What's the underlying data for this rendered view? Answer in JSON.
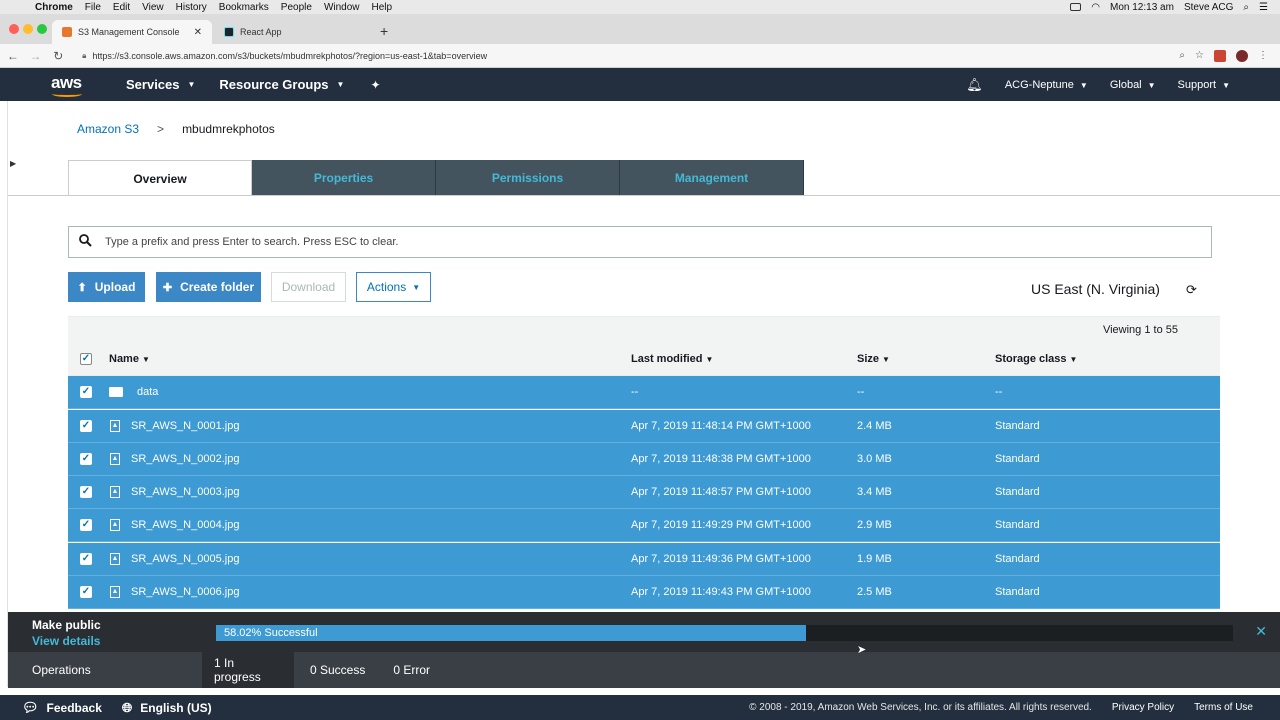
{
  "mac_menu": {
    "app": "Chrome",
    "items": [
      "File",
      "Edit",
      "View",
      "History",
      "Bookmarks",
      "People",
      "Window",
      "Help"
    ],
    "clock": "Mon 12:13 am",
    "user": "Steve ACG"
  },
  "browser": {
    "tabs": [
      {
        "title": "S3 Management Console",
        "active": true
      },
      {
        "title": "React App",
        "active": false
      }
    ],
    "url": "https://s3.console.aws.amazon.com/s3/buckets/mbudmrekphotos/?region=us-east-1&tab=overview"
  },
  "aws_nav": {
    "logo": "aws",
    "services": "Services",
    "resource_groups": "Resource Groups",
    "account": "ACG-Neptune",
    "region": "Global",
    "support": "Support"
  },
  "breadcrumb": {
    "root": "Amazon S3",
    "separator": ">",
    "bucket": "mbudmrekphotos"
  },
  "tabs": [
    "Overview",
    "Properties",
    "Permissions",
    "Management"
  ],
  "search": {
    "placeholder": "Type a prefix and press Enter to search. Press ESC to clear."
  },
  "toolbar": {
    "upload": "Upload",
    "create_folder": "Create folder",
    "download": "Download",
    "actions": "Actions",
    "region": "US East (N. Virginia)"
  },
  "viewing": "Viewing 1 to 55",
  "table": {
    "headers": {
      "name": "Name",
      "modified": "Last modified",
      "size": "Size",
      "storage": "Storage class"
    },
    "rows": [
      {
        "name": "data",
        "modified": "--",
        "size": "--",
        "storage": "--",
        "type": "folder"
      },
      {
        "name": "SR_AWS_N_0001.jpg",
        "modified": "Apr 7, 2019 11:48:14 PM GMT+1000",
        "size": "2.4 MB",
        "storage": "Standard",
        "type": "file"
      },
      {
        "name": "SR_AWS_N_0002.jpg",
        "modified": "Apr 7, 2019 11:48:38 PM GMT+1000",
        "size": "3.0 MB",
        "storage": "Standard",
        "type": "file"
      },
      {
        "name": "SR_AWS_N_0003.jpg",
        "modified": "Apr 7, 2019 11:48:57 PM GMT+1000",
        "size": "3.4 MB",
        "storage": "Standard",
        "type": "file"
      },
      {
        "name": "SR_AWS_N_0004.jpg",
        "modified": "Apr 7, 2019 11:49:29 PM GMT+1000",
        "size": "2.9 MB",
        "storage": "Standard",
        "type": "file"
      },
      {
        "name": "SR_AWS_N_0005.jpg",
        "modified": "Apr 7, 2019 11:49:36 PM GMT+1000",
        "size": "1.9 MB",
        "storage": "Standard",
        "type": "file"
      },
      {
        "name": "SR_AWS_N_0006.jpg",
        "modified": "Apr 7, 2019 11:49:43 PM GMT+1000",
        "size": "2.5 MB",
        "storage": "Standard",
        "type": "file"
      }
    ]
  },
  "operations": {
    "title": "Make public",
    "details_link": "View details",
    "progress_text": "58.02% Successful",
    "progress_fraction": 0.5802,
    "label": "Operations",
    "in_progress": "1 In progress",
    "success": "0 Success",
    "error": "0 Error"
  },
  "footer": {
    "feedback": "Feedback",
    "language": "English (US)",
    "copyright": "© 2008 - 2019, Amazon Web Services, Inc. or its affiliates. All rights reserved.",
    "privacy": "Privacy Policy",
    "terms": "Terms of Use"
  },
  "colors": {
    "aws_nav": "#232f3e",
    "selected_row": "#3d9ad3",
    "primary_button": "#3c88c7",
    "tab_text": "#44b9d6",
    "link": "#0073bb",
    "aws_orange": "#ff9900"
  }
}
